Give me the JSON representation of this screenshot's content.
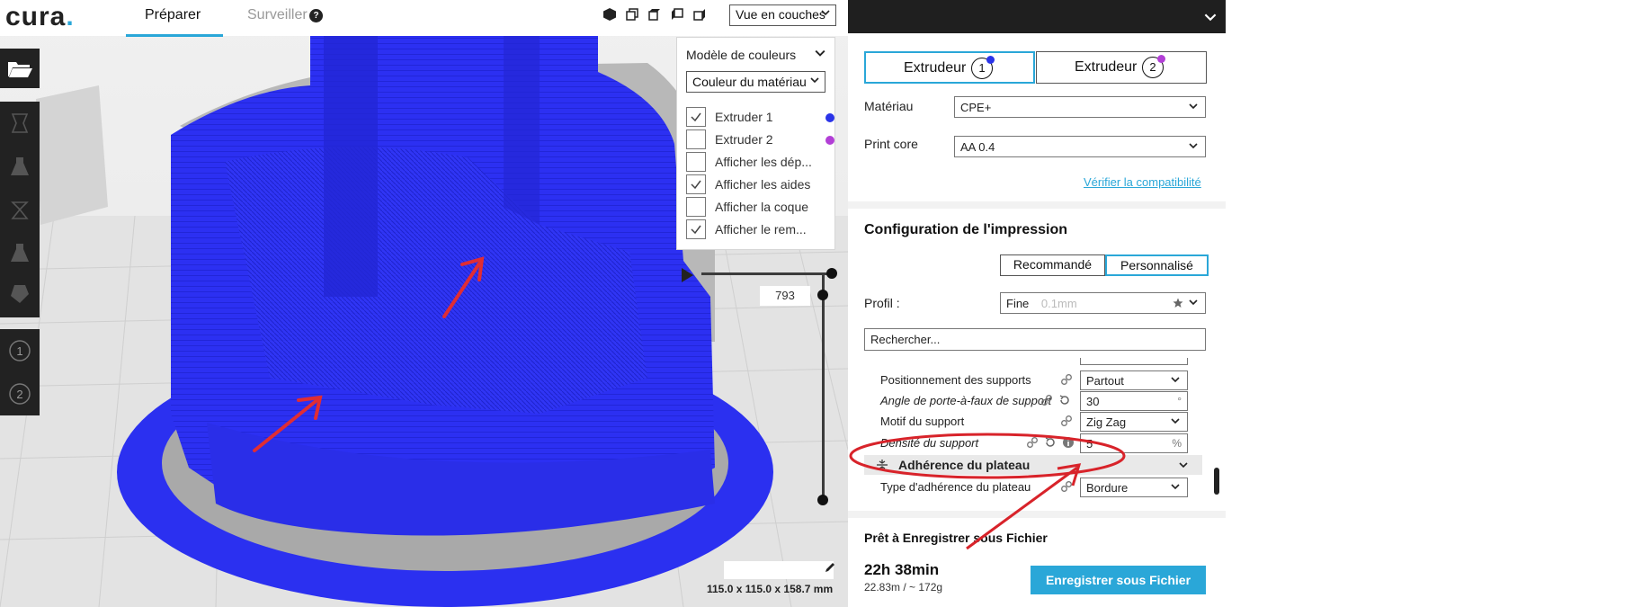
{
  "app": {
    "logo_text": "cura",
    "accent_color": "#2aa7d8",
    "tabs": [
      {
        "label": "Préparer",
        "active": true
      },
      {
        "label": "Surveiller",
        "active": false
      }
    ],
    "view_mode": "Vue en couches"
  },
  "toolbar": {
    "items": [
      "open-folder-icon",
      "move-icon",
      "scale-icon",
      "rotate-icon",
      "mirror-icon",
      "per-model-settings-icon",
      "support-blocker-icon"
    ],
    "extruders": [
      "1",
      "2"
    ]
  },
  "legend": {
    "title": "Modèle de couleurs",
    "scheme": "Couleur du matériau",
    "items": [
      {
        "label": "Extruder 1",
        "checked": true,
        "color": "#2b34e8"
      },
      {
        "label": "Extruder 2",
        "checked": false,
        "color": "#b23fd6"
      },
      {
        "label": "Afficher les dép...",
        "checked": false
      },
      {
        "label": "Afficher les aides",
        "checked": true
      },
      {
        "label": "Afficher la coque",
        "checked": false
      },
      {
        "label": "Afficher le rem...",
        "checked": true
      }
    ]
  },
  "layer_view": {
    "current_layer": "793"
  },
  "model": {
    "dimensions": "115.0 x 115.0 x 158.7 mm",
    "color": "#2b30f0"
  },
  "print_panel": {
    "extruders": [
      {
        "label": "Extrudeur",
        "number": "1",
        "selected": true,
        "color": "#2b34e8"
      },
      {
        "label": "Extrudeur",
        "number": "2",
        "selected": false,
        "color": "#b23fd6"
      }
    ],
    "material_label": "Matériau",
    "material_value": "CPE+",
    "printcore_label": "Print core",
    "printcore_value": "AA 0.4",
    "compat_link": "Vérifier la compatibilité",
    "section_title": "Configuration de l'impression",
    "modes": [
      "Recommandé",
      "Personnalisé"
    ],
    "profile_label": "Profil :",
    "profile_value": "Fine",
    "profile_hint": "0.1mm",
    "search_value": "Rechercher...",
    "settings": [
      {
        "name": "Positionnement des supports",
        "italic": false,
        "value": "Partout",
        "type": "select"
      },
      {
        "name": "Angle de porte-à-faux de support",
        "italic": true,
        "value": "30",
        "unit": "°",
        "type": "number"
      },
      {
        "name": "Motif du support",
        "italic": false,
        "value": "Zig Zag",
        "type": "select"
      },
      {
        "name": "Densité du support",
        "italic": true,
        "value": "5",
        "unit": "%",
        "type": "number"
      }
    ],
    "category": "Adhérence du plateau",
    "adhesion_setting": {
      "name": "Type d'adhérence du plateau",
      "value": "Bordure"
    }
  },
  "footer": {
    "ready_text": "Prêt à Enregistrer sous Fichier",
    "time": "22h 38min",
    "material_usage": "22.83m / ~ 172g",
    "save_button": "Enregistrer sous Fichier"
  },
  "annotation_color": "#d8232a"
}
